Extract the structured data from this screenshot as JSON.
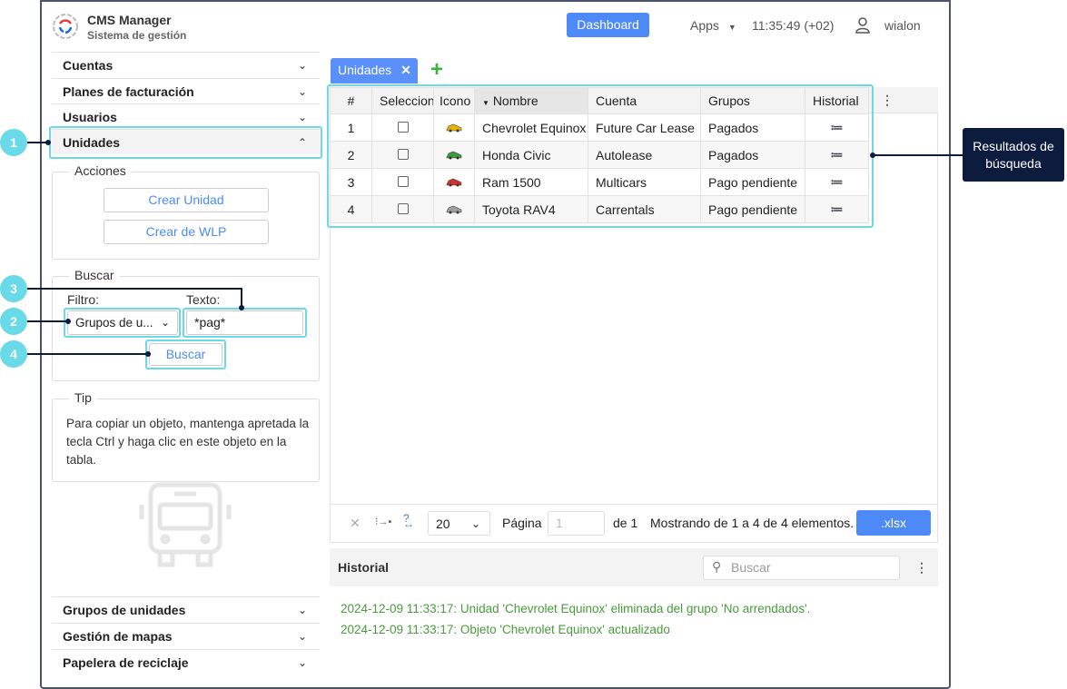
{
  "app": {
    "title": "CMS Manager",
    "subtitle": "Sistema de gestión"
  },
  "header": {
    "dashboard": "Dashboard",
    "apps": "Apps",
    "time": "11:35:49 (+02)",
    "user": "wialon"
  },
  "sidebar": {
    "top_items": [
      {
        "label": "Cuentas"
      },
      {
        "label": "Planes de facturación"
      },
      {
        "label": "Usuarios"
      },
      {
        "label": "Unidades"
      }
    ],
    "actions": {
      "legend": "Acciones",
      "create_unit": "Crear Unidad",
      "create_wlp": "Crear de WLP"
    },
    "search": {
      "legend": "Buscar",
      "filter_label": "Filtro:",
      "filter_value": "Grupos de u...",
      "text_label": "Texto:",
      "text_value": "*pag*",
      "button": "Buscar"
    },
    "tip": {
      "legend": "Tip",
      "text": "Para copiar un objeto, mantenga apretada la tecla Ctrl y haga clic en este objeto en la tabla."
    },
    "bottom_items": [
      {
        "label": "Grupos de unidades"
      },
      {
        "label": "Gestión de mapas"
      },
      {
        "label": "Papelera de reciclaje"
      }
    ]
  },
  "tab": {
    "label": "Unidades"
  },
  "table": {
    "headers": [
      "#",
      "Seleccionar",
      "Icono",
      "Nombre",
      "Cuenta",
      "Grupos",
      "Historial"
    ],
    "rows": [
      {
        "n": "1",
        "name": "Chevrolet Equinox",
        "account": "Future Car Lease",
        "group": "Pagados",
        "color": "#e8b400"
      },
      {
        "n": "2",
        "name": "Honda Civic",
        "account": "Autolease",
        "group": "Pagados",
        "color": "#3e9a3e"
      },
      {
        "n": "3",
        "name": "Ram 1500",
        "account": "Multicars",
        "group": "Pago pendiente",
        "color": "#d0312d"
      },
      {
        "n": "4",
        "name": "Toyota RAV4",
        "account": "Carrentals",
        "group": "Pago pendiente",
        "color": "#9aa0a6"
      }
    ]
  },
  "footer": {
    "page_size": "20",
    "page_label": "Página",
    "page_value": "1",
    "of": "de 1",
    "showing": "Mostrando de 1 a 4 de 4 elementos.",
    "export": ".xlsx"
  },
  "history": {
    "title": "Historial",
    "search_placeholder": "Buscar",
    "entries": [
      "2024-12-09 11:33:17: Unidad 'Chevrolet Equinox' eliminada del grupo 'No arrendados'.",
      "2024-12-09 11:33:17: Objeto 'Chevrolet Equinox' actualizado"
    ]
  },
  "callouts": {
    "c1": "1",
    "c2": "2",
    "c3": "3",
    "c4": "4",
    "results": "Resultados de búsqueda"
  }
}
